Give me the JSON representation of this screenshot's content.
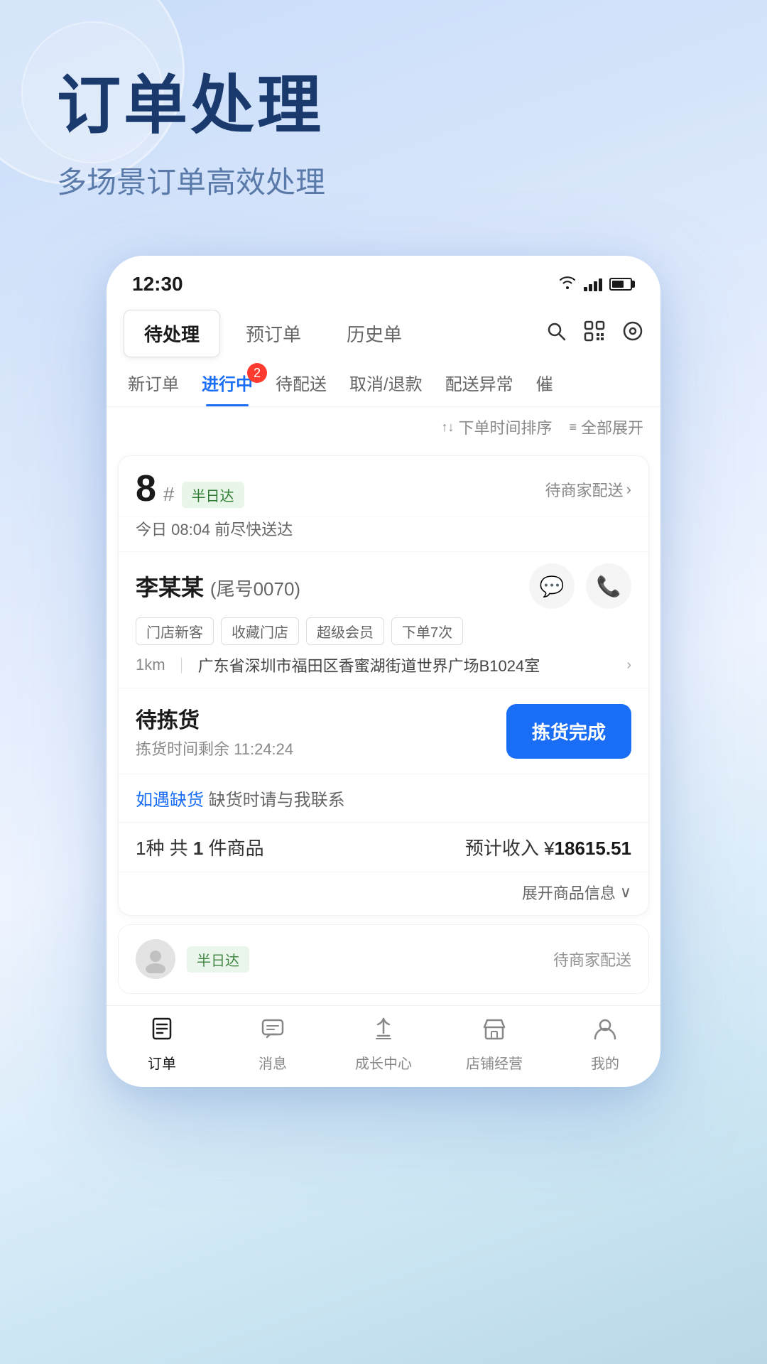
{
  "header": {
    "title": "订单处理",
    "subtitle": "多场景订单高效处理"
  },
  "status_bar": {
    "time": "12:30"
  },
  "top_tabs": {
    "tabs": [
      {
        "label": "待处理",
        "active": true
      },
      {
        "label": "预订单",
        "active": false
      },
      {
        "label": "历史单",
        "active": false
      }
    ]
  },
  "sub_tabs": {
    "tabs": [
      {
        "label": "新订单",
        "active": false,
        "badge": null
      },
      {
        "label": "进行中",
        "active": true,
        "badge": "2"
      },
      {
        "label": "待配送",
        "active": false,
        "badge": null
      },
      {
        "label": "取消/退款",
        "active": false,
        "badge": null
      },
      {
        "label": "配送异常",
        "active": false,
        "badge": null
      },
      {
        "label": "催",
        "active": false,
        "badge": null
      }
    ]
  },
  "sort_bar": {
    "sort_label": "下单时间排序",
    "expand_label": "全部展开"
  },
  "order_card": {
    "number": "8",
    "hash": "#",
    "delivery_type": "半日达",
    "delivery_status": "待商家配送",
    "delivery_time": "今日 08:04 前尽快送达",
    "customer": {
      "name": "李某某",
      "id_suffix": "(尾号0070)",
      "tags": [
        "门店新客",
        "收藏门店",
        "超级会员",
        "下单7次"
      ],
      "distance": "1km",
      "address": "广东省深圳市福田区香蜜湖街道世界广场B1024室"
    },
    "picking": {
      "title": "待拣货",
      "timer_prefix": "拣货时间剩余",
      "timer": "11:24:24",
      "button": "拣货完成"
    },
    "shortage": {
      "link_text": "如遇缺货",
      "text": " 缺货时请与我联系"
    },
    "summary": {
      "count_prefix": "1种 共",
      "count": "1",
      "count_suffix": "件商品",
      "amount_prefix": "预计收入 ¥",
      "amount": "18615.51"
    },
    "expand_label": "展开商品信息"
  },
  "second_card": {
    "delivery_badge": "半日达",
    "status": "待商家配送"
  },
  "bottom_nav": {
    "items": [
      {
        "label": "订单",
        "active": true,
        "icon": "order"
      },
      {
        "label": "消息",
        "active": false,
        "icon": "message"
      },
      {
        "label": "成长中心",
        "active": false,
        "icon": "growth"
      },
      {
        "label": "店铺经营",
        "active": false,
        "icon": "store"
      },
      {
        "label": "我的",
        "active": false,
        "icon": "profile"
      }
    ]
  }
}
